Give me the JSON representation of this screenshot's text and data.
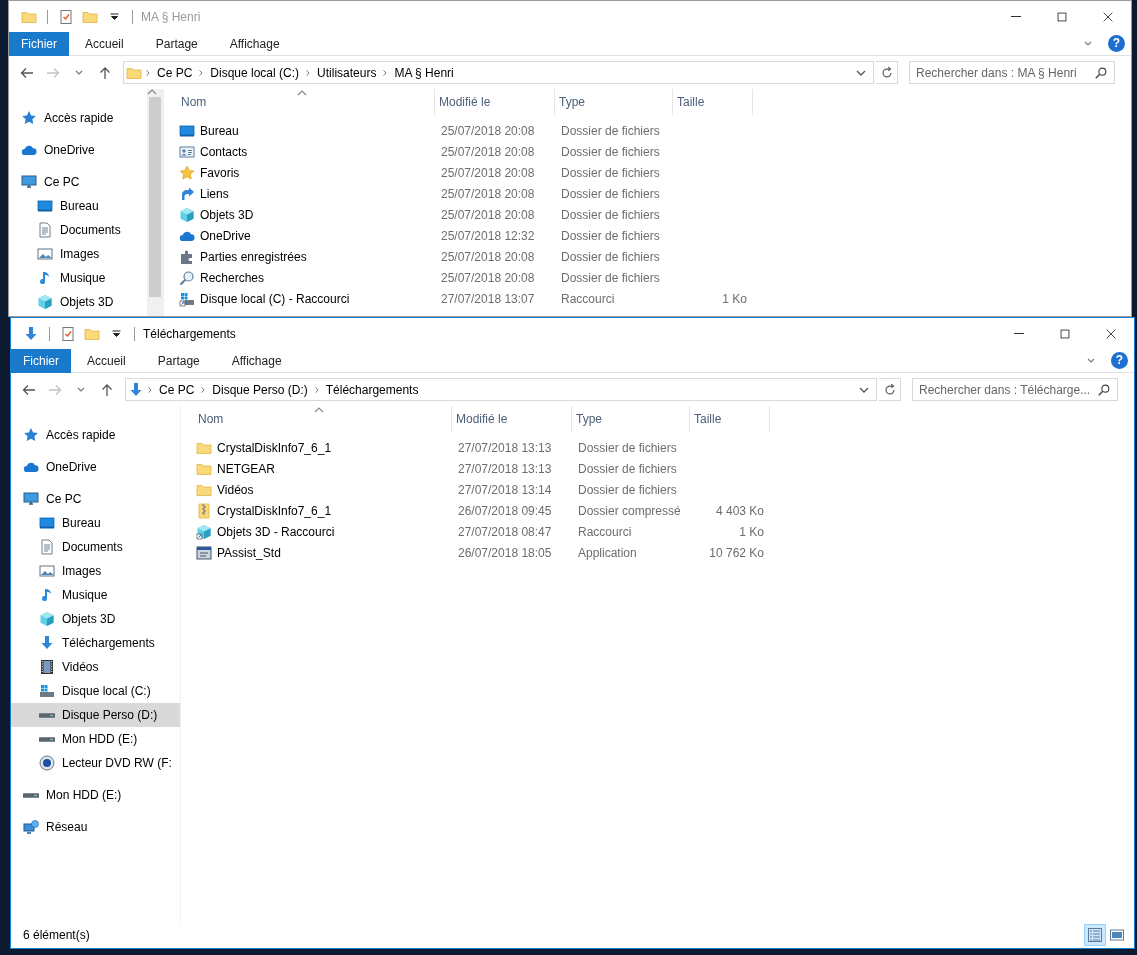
{
  "windows": [
    {
      "title": "MA § Henri",
      "active": false,
      "kind": "folder",
      "ribbon": {
        "tabs": [
          {
            "label": "Fichier",
            "kind": "file-menu"
          },
          {
            "label": "Accueil",
            "kind": "tab"
          },
          {
            "label": "Partage",
            "kind": "tab"
          },
          {
            "label": "Affichage",
            "kind": "tab"
          }
        ],
        "help": "?"
      },
      "nav_buttons": [
        {
          "kind": "back",
          "disabled": false
        },
        {
          "kind": "forward",
          "disabled": true
        }
      ],
      "address": [
        "Ce PC",
        "Disque local (C:)",
        "Utilisateurs",
        "MA § Henri"
      ],
      "search": {
        "placeholder": "Rechercher dans : MA § Henri"
      },
      "nav_scrollbar": true,
      "navigation": [
        {
          "label": "Accès rapide",
          "kind": "quick-access",
          "selected": false
        },
        {
          "label": "OneDrive",
          "kind": "cloud",
          "selected": false
        },
        {
          "label": "Ce PC",
          "kind": "pc",
          "selected": false,
          "children": [
            {
              "label": "Bureau",
              "kind": "desktop",
              "selected": false
            },
            {
              "label": "Documents",
              "kind": "documents",
              "selected": false
            },
            {
              "label": "Images",
              "kind": "pictures",
              "selected": false
            },
            {
              "label": "Musique",
              "kind": "music",
              "selected": false
            },
            {
              "label": "Objets 3D",
              "kind": "cube",
              "selected": false
            }
          ]
        }
      ],
      "columns": [
        {
          "label": "Nom",
          "sorted": true
        },
        {
          "label": "Modifié le"
        },
        {
          "label": "Type"
        },
        {
          "label": "Taille"
        }
      ],
      "rows": [
        {
          "kind": "desktop",
          "name": "Bureau",
          "modified": "25/07/2018 20:08",
          "type": "Dossier de fichiers"
        },
        {
          "kind": "contacts",
          "name": "Contacts",
          "modified": "25/07/2018 20:08",
          "type": "Dossier de fichiers"
        },
        {
          "kind": "favorites",
          "name": "Favoris",
          "modified": "25/07/2018 20:08",
          "type": "Dossier de fichiers"
        },
        {
          "kind": "links",
          "name": "Liens",
          "modified": "25/07/2018 20:08",
          "type": "Dossier de fichiers"
        },
        {
          "kind": "cube",
          "name": "Objets 3D",
          "modified": "25/07/2018 20:08",
          "type": "Dossier de fichiers"
        },
        {
          "kind": "cloud",
          "name": "OneDrive",
          "modified": "25/07/2018 12:32",
          "type": "Dossier de fichiers"
        },
        {
          "kind": "saved-games",
          "name": "Parties enregistrées",
          "modified": "25/07/2018 20:08",
          "type": "Dossier de fichiers"
        },
        {
          "kind": "searches",
          "name": "Recherches",
          "modified": "25/07/2018 20:08",
          "type": "Dossier de fichiers"
        },
        {
          "kind": "drive-shortcut",
          "name": "Disque local (C) - Raccourci",
          "modified": "27/07/2018 13:07",
          "type": "Raccourci",
          "size": "1 Ko"
        }
      ]
    },
    {
      "title": "Téléchargements",
      "active": true,
      "kind": "downloads",
      "ribbon": {
        "tabs": [
          {
            "label": "Fichier",
            "kind": "file-menu"
          },
          {
            "label": "Accueil",
            "kind": "tab"
          },
          {
            "label": "Partage",
            "kind": "tab"
          },
          {
            "label": "Affichage",
            "kind": "tab"
          }
        ],
        "help": "?"
      },
      "nav_buttons": [
        {
          "kind": "back",
          "disabled": false
        },
        {
          "kind": "forward",
          "disabled": true
        }
      ],
      "address": [
        "Ce PC",
        "Disque Perso (D:)",
        "Téléchargements"
      ],
      "search": {
        "placeholder": "Rechercher dans : Télécharge..."
      },
      "navigation": [
        {
          "label": "Accès rapide",
          "kind": "quick-access",
          "selected": false
        },
        {
          "label": "OneDrive",
          "kind": "cloud",
          "selected": false
        },
        {
          "label": "Ce PC",
          "kind": "pc",
          "selected": false,
          "children": [
            {
              "label": "Bureau",
              "kind": "desktop",
              "selected": false
            },
            {
              "label": "Documents",
              "kind": "documents",
              "selected": false
            },
            {
              "label": "Images",
              "kind": "pictures",
              "selected": false
            },
            {
              "label": "Musique",
              "kind": "music",
              "selected": false
            },
            {
              "label": "Objets 3D",
              "kind": "cube",
              "selected": false
            },
            {
              "label": "Téléchargements",
              "kind": "downloads",
              "selected": false
            },
            {
              "label": "Vidéos",
              "kind": "videos",
              "selected": false
            },
            {
              "label": "Disque local (C:)",
              "kind": "drive-windows",
              "selected": false
            },
            {
              "label": "Disque Perso (D:)",
              "kind": "drive",
              "selected": true
            },
            {
              "label": "Mon HDD (E:)",
              "kind": "drive",
              "selected": false
            },
            {
              "label": "Lecteur DVD RW (F:",
              "kind": "dvd",
              "selected": false
            }
          ]
        },
        {
          "label": "Mon HDD (E:)",
          "kind": "drive",
          "selected": false
        },
        {
          "label": "Réseau",
          "kind": "network",
          "selected": false
        }
      ],
      "columns": [
        {
          "label": "Nom",
          "sorted": true
        },
        {
          "label": "Modifié le"
        },
        {
          "label": "Type"
        },
        {
          "label": "Taille"
        }
      ],
      "rows": [
        {
          "kind": "folder",
          "name": "CrystalDiskInfo7_6_1",
          "modified": "27/07/2018 13:13",
          "type": "Dossier de fichiers"
        },
        {
          "kind": "folder",
          "name": "NETGEAR",
          "modified": "27/07/2018 13:13",
          "type": "Dossier de fichiers"
        },
        {
          "kind": "folder",
          "name": "Vidéos",
          "modified": "27/07/2018 13:14",
          "type": "Dossier de fichiers"
        },
        {
          "kind": "zip",
          "name": "CrystalDiskInfo7_6_1",
          "modified": "26/07/2018 09:45",
          "type": "Dossier compressé",
          "size": "4 403 Ko"
        },
        {
          "kind": "cube-shortcut",
          "name": "Objets 3D - Raccourci",
          "modified": "27/07/2018 08:47",
          "type": "Raccourci",
          "size": "1 Ko"
        },
        {
          "kind": "app",
          "name": "PAssist_Std",
          "modified": "26/07/2018 18:05",
          "type": "Application",
          "size": "10 762 Ko"
        }
      ],
      "status": {
        "text": "6 élément(s)",
        "views": [
          {
            "kind": "details",
            "selected": true
          },
          {
            "kind": "large-icons",
            "selected": false
          }
        ]
      }
    }
  ]
}
